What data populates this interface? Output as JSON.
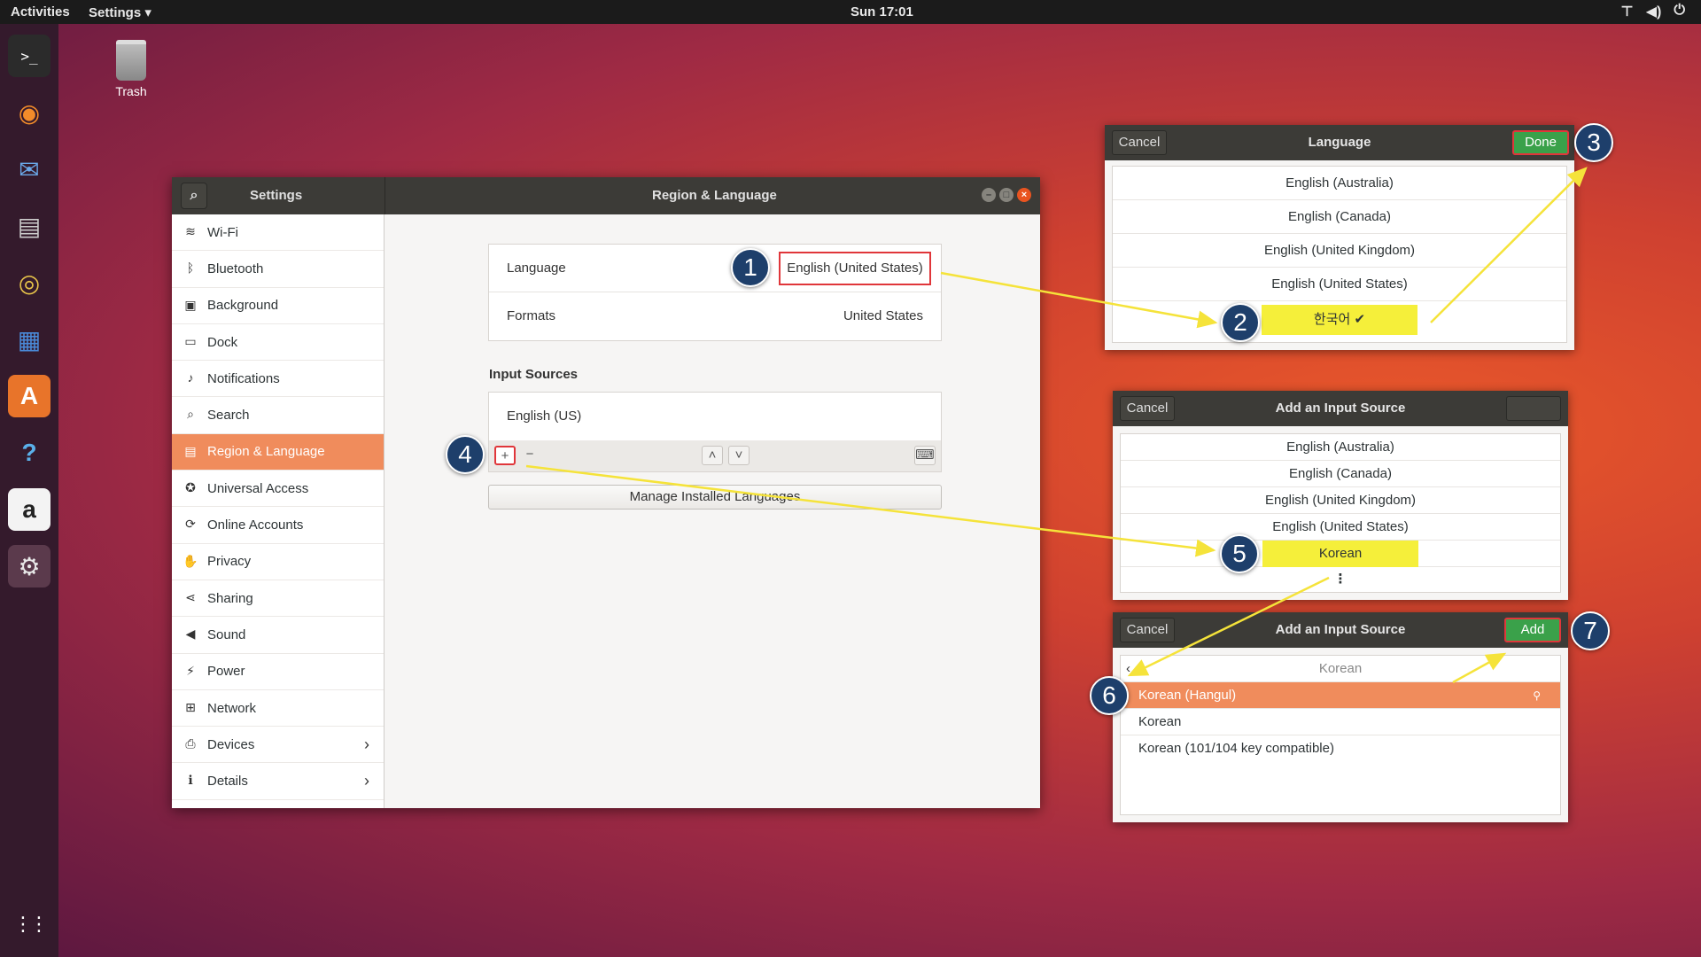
{
  "topbar": {
    "activities": "Activities",
    "app_menu": "Settings ▾",
    "clock": "Sun 17:01"
  },
  "desktop": {
    "trash_label": "Trash"
  },
  "dock": {
    "items": [
      {
        "icon": "terminal-icon",
        "glyph": ">_"
      },
      {
        "icon": "firefox-icon",
        "glyph": "◉"
      },
      {
        "icon": "thunderbird-icon",
        "glyph": "✉"
      },
      {
        "icon": "files-icon",
        "glyph": "▤"
      },
      {
        "icon": "rhythmbox-icon",
        "glyph": "◎"
      },
      {
        "icon": "libreoffice-writer-icon",
        "glyph": "▦"
      },
      {
        "icon": "software-center-icon",
        "glyph": "A"
      },
      {
        "icon": "help-icon",
        "glyph": "?"
      },
      {
        "icon": "amazon-icon",
        "glyph": "a"
      },
      {
        "icon": "settings-icon",
        "glyph": "⚙"
      },
      {
        "icon": "show-apps-icon",
        "glyph": "⋮⋮"
      }
    ]
  },
  "settings": {
    "sidebar_title": "Settings",
    "main_title": "Region & Language",
    "sidebar": [
      {
        "label": "Wi-Fi",
        "icon": "wifi-icon",
        "glyph": "≋"
      },
      {
        "label": "Bluetooth",
        "icon": "bluetooth-icon",
        "glyph": "ᛒ"
      },
      {
        "label": "Background",
        "icon": "background-icon",
        "glyph": "▣"
      },
      {
        "label": "Dock",
        "icon": "dock-icon",
        "glyph": "▭"
      },
      {
        "label": "Notifications",
        "icon": "bell-icon",
        "glyph": "♪"
      },
      {
        "label": "Search",
        "icon": "search-icon",
        "glyph": "⌕"
      },
      {
        "label": "Region & Language",
        "icon": "region-icon",
        "glyph": "▤"
      },
      {
        "label": "Universal Access",
        "icon": "accessibility-icon",
        "glyph": "✪"
      },
      {
        "label": "Online Accounts",
        "icon": "online-accounts-icon",
        "glyph": "⟳"
      },
      {
        "label": "Privacy",
        "icon": "privacy-icon",
        "glyph": "✋"
      },
      {
        "label": "Sharing",
        "icon": "share-icon",
        "glyph": "⋖"
      },
      {
        "label": "Sound",
        "icon": "sound-icon",
        "glyph": "◀"
      },
      {
        "label": "Power",
        "icon": "power-icon",
        "glyph": "⚡"
      },
      {
        "label": "Network",
        "icon": "network-icon",
        "glyph": "⊞"
      },
      {
        "label": "Devices",
        "icon": "devices-icon",
        "glyph": "⎙"
      },
      {
        "label": "Details",
        "icon": "details-icon",
        "glyph": "ℹ"
      }
    ],
    "language_label": "Language",
    "language_value": "English (United States)",
    "formats_label": "Formats",
    "formats_value": "United States",
    "input_sources_title": "Input Sources",
    "input_source_1": "English (US)",
    "manage_button": "Manage Installed Languages"
  },
  "language_dialog": {
    "cancel": "Cancel",
    "title": "Language",
    "done": "Done",
    "items": [
      "English (Australia)",
      "English (Canada)",
      "English (United Kingdom)",
      "English (United States)",
      "한국어 ✔"
    ]
  },
  "input_dialog_1": {
    "cancel": "Cancel",
    "title": "Add an Input Source",
    "items": [
      "English (Australia)",
      "English (Canada)",
      "English (United Kingdom)",
      "English (United States)",
      "Korean",
      "⋮"
    ]
  },
  "input_dialog_2": {
    "cancel": "Cancel",
    "title": "Add an Input Source",
    "add": "Add",
    "search_value": "Korean",
    "items": [
      "Korean (Hangul)",
      "Korean",
      "Korean (101/104 key compatible)"
    ]
  },
  "steps": [
    "1",
    "2",
    "3",
    "4",
    "5",
    "6",
    "7"
  ],
  "colors": {
    "accent": "#e95420",
    "highlight": "#f5ef3a",
    "annotation_red": "#e0363a",
    "badge": "#1e3f6b",
    "done_green": "#3aa14a"
  }
}
